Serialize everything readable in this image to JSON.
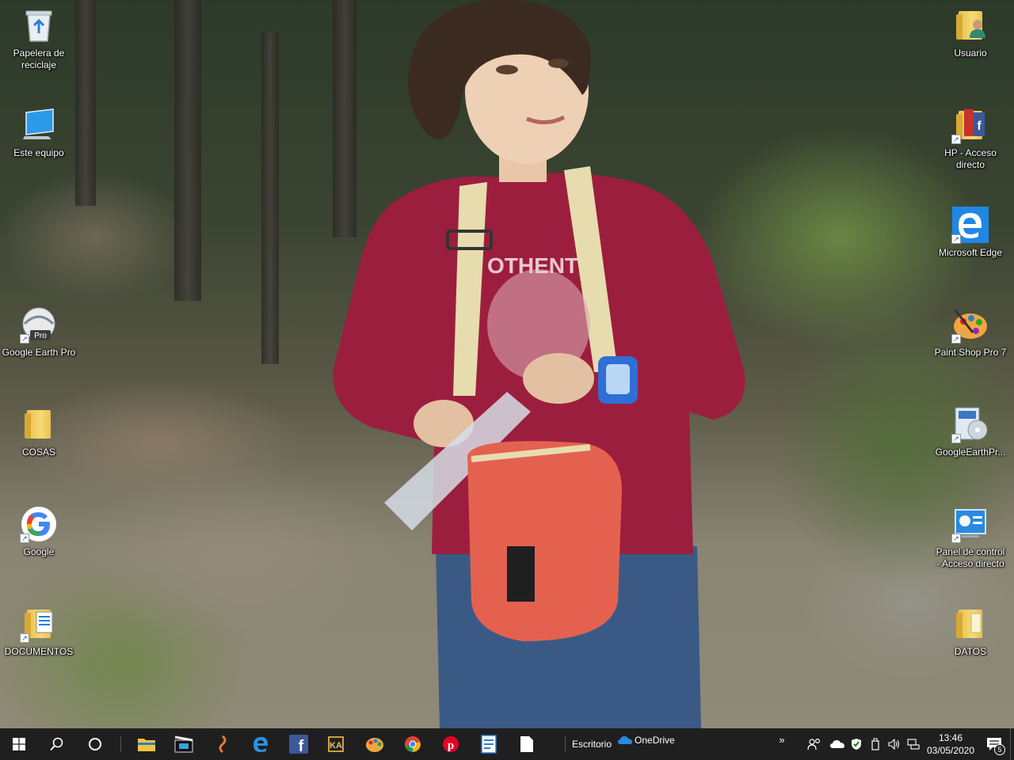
{
  "desktop": {
    "left_icons": [
      {
        "label": "Papelera de reciclaje",
        "icon": "recycle-bin-icon"
      },
      {
        "label": "Este equipo",
        "icon": "computer-icon"
      },
      {
        "label": "Google Earth Pro",
        "icon": "google-earth-icon",
        "badge": "Pro"
      },
      {
        "label": "COSAS",
        "icon": "folder-icon"
      },
      {
        "label": "Google",
        "icon": "google-chrome-app-icon"
      },
      {
        "label": "DOCUMENTOS",
        "icon": "documents-folder-icon"
      }
    ],
    "right_icons": [
      {
        "label": "Usuario",
        "icon": "user-folder-icon"
      },
      {
        "label": "HP - Acceso directo",
        "icon": "hp-shortcut-icon"
      },
      {
        "label": "Microsoft Edge",
        "icon": "edge-icon"
      },
      {
        "label": "Paint Shop Pro 7",
        "icon": "paint-palette-icon"
      },
      {
        "label": "GoogleEarthPr...",
        "icon": "installer-icon"
      },
      {
        "label": "Panel de control - Acceso directo",
        "icon": "control-panel-icon"
      },
      {
        "label": "DATOS",
        "icon": "folder-icon"
      }
    ]
  },
  "taskbar": {
    "toolbar_label": "Escritorio",
    "onedrive_label": "OneDrive",
    "chevron": "»",
    "clock_time": "13:46",
    "clock_date": "03/05/2020",
    "notification_count": "5"
  },
  "colors": {
    "taskbar": "#1f1f1f",
    "accent": "#76b9ed"
  }
}
